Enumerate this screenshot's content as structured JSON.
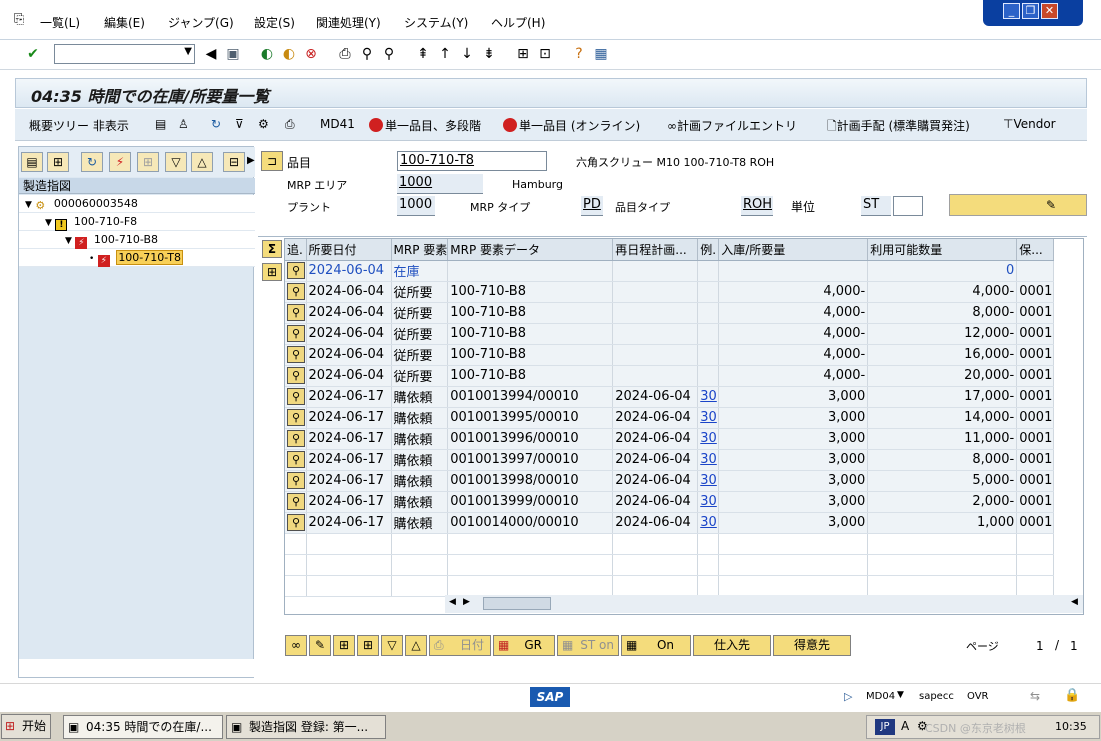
{
  "menu": [
    "一覧(L)",
    "編集(E)",
    "ジャンプ(G)",
    "設定(S)",
    "関連処理(Y)",
    "システム(Y)",
    "ヘルプ(H)"
  ],
  "toolbar": {
    "command_value": ""
  },
  "title": "04:35 時間での在庫/所要量一覧",
  "app_toolbar": {
    "hide_tree": "概要ツリー 非表示",
    "md41": "MD41",
    "single_multi": "単一品目、多段階",
    "single_online": "単一品目 (オンライン)",
    "plan_file": "計画ファイルエントリ",
    "plan_proc": "計画手配 (標準購買発注)",
    "vendor": "Vendor"
  },
  "tree": {
    "header": "製造指図",
    "nodes": [
      "000060003548",
      "100-710-F8",
      "100-710-B8",
      "100-710-T8"
    ]
  },
  "header_fields": {
    "material_label": "品目",
    "material_value": "100-710-T8",
    "material_desc": "六角スクリュー M10 100-710-T8 ROH",
    "mrp_area_label": "MRP エリア",
    "mrp_area_value": "1000",
    "mrp_area_desc": "Hamburg",
    "plant_label": "プラント",
    "plant_value": "1000",
    "mrp_type_label": "MRP タイプ",
    "mrp_type_value": "PD",
    "mat_type_label": "品目タイプ",
    "mat_type_value": "ROH",
    "unit_label": "単位",
    "unit_value": "ST"
  },
  "grid": {
    "columns": [
      "追.",
      "所要日付",
      "MRP 要素",
      "MRP 要素データ",
      "再日程計画...",
      "例.",
      "入庫/所要量",
      "利用可能数量",
      "保..."
    ],
    "rows": [
      {
        "date": "2024-06-04",
        "elem": "在庫",
        "data": "",
        "resched": "",
        "exc": "",
        "qty": "",
        "avail": "0",
        "stor": "",
        "blue": true
      },
      {
        "date": "2024-06-04",
        "elem": "従所要",
        "data": "100-710-B8",
        "resched": "",
        "exc": "",
        "qty": "4,000-",
        "avail": "4,000-",
        "stor": "0001"
      },
      {
        "date": "2024-06-04",
        "elem": "従所要",
        "data": "100-710-B8",
        "resched": "",
        "exc": "",
        "qty": "4,000-",
        "avail": "8,000-",
        "stor": "0001"
      },
      {
        "date": "2024-06-04",
        "elem": "従所要",
        "data": "100-710-B8",
        "resched": "",
        "exc": "",
        "qty": "4,000-",
        "avail": "12,000-",
        "stor": "0001"
      },
      {
        "date": "2024-06-04",
        "elem": "従所要",
        "data": "100-710-B8",
        "resched": "",
        "exc": "",
        "qty": "4,000-",
        "avail": "16,000-",
        "stor": "0001"
      },
      {
        "date": "2024-06-04",
        "elem": "従所要",
        "data": "100-710-B8",
        "resched": "",
        "exc": "",
        "qty": "4,000-",
        "avail": "20,000-",
        "stor": "0001"
      },
      {
        "date": "2024-06-17",
        "elem": "購依頼",
        "data": "0010013994/00010",
        "resched": "2024-06-04",
        "exc": "30",
        "qty": "3,000",
        "avail": "17,000-",
        "stor": "0001"
      },
      {
        "date": "2024-06-17",
        "elem": "購依頼",
        "data": "0010013995/00010",
        "resched": "2024-06-04",
        "exc": "30",
        "qty": "3,000",
        "avail": "14,000-",
        "stor": "0001"
      },
      {
        "date": "2024-06-17",
        "elem": "購依頼",
        "data": "0010013996/00010",
        "resched": "2024-06-04",
        "exc": "30",
        "qty": "3,000",
        "avail": "11,000-",
        "stor": "0001"
      },
      {
        "date": "2024-06-17",
        "elem": "購依頼",
        "data": "0010013997/00010",
        "resched": "2024-06-04",
        "exc": "30",
        "qty": "3,000",
        "avail": "8,000-",
        "stor": "0001"
      },
      {
        "date": "2024-06-17",
        "elem": "購依頼",
        "data": "0010013998/00010",
        "resched": "2024-06-04",
        "exc": "30",
        "qty": "3,000",
        "avail": "5,000-",
        "stor": "0001"
      },
      {
        "date": "2024-06-17",
        "elem": "購依頼",
        "data": "0010013999/00010",
        "resched": "2024-06-04",
        "exc": "30",
        "qty": "3,000",
        "avail": "2,000-",
        "stor": "0001"
      },
      {
        "date": "2024-06-17",
        "elem": "購依頼",
        "data": "0010014000/00010",
        "resched": "2024-06-04",
        "exc": "30",
        "qty": "3,000",
        "avail": "1,000",
        "stor": "0001"
      }
    ]
  },
  "bottom_buttons": {
    "date": "日付",
    "gr": "GR",
    "st_on": "ST on",
    "on": "On",
    "vendor": "仕入先",
    "customer": "得意先"
  },
  "page": {
    "label": "ページ",
    "current": "1",
    "total": "1"
  },
  "status": {
    "logo": "SAP",
    "tcode": "MD04",
    "server": "sapecc",
    "mode": "OVR"
  },
  "taskbar": {
    "start": "开始",
    "task1": "04:35 時間での在庫/...",
    "task2": "製造指図 登録: 第一...",
    "lang": "JP",
    "time": "10:35",
    "watermark": "CSDN @东京老树根"
  }
}
